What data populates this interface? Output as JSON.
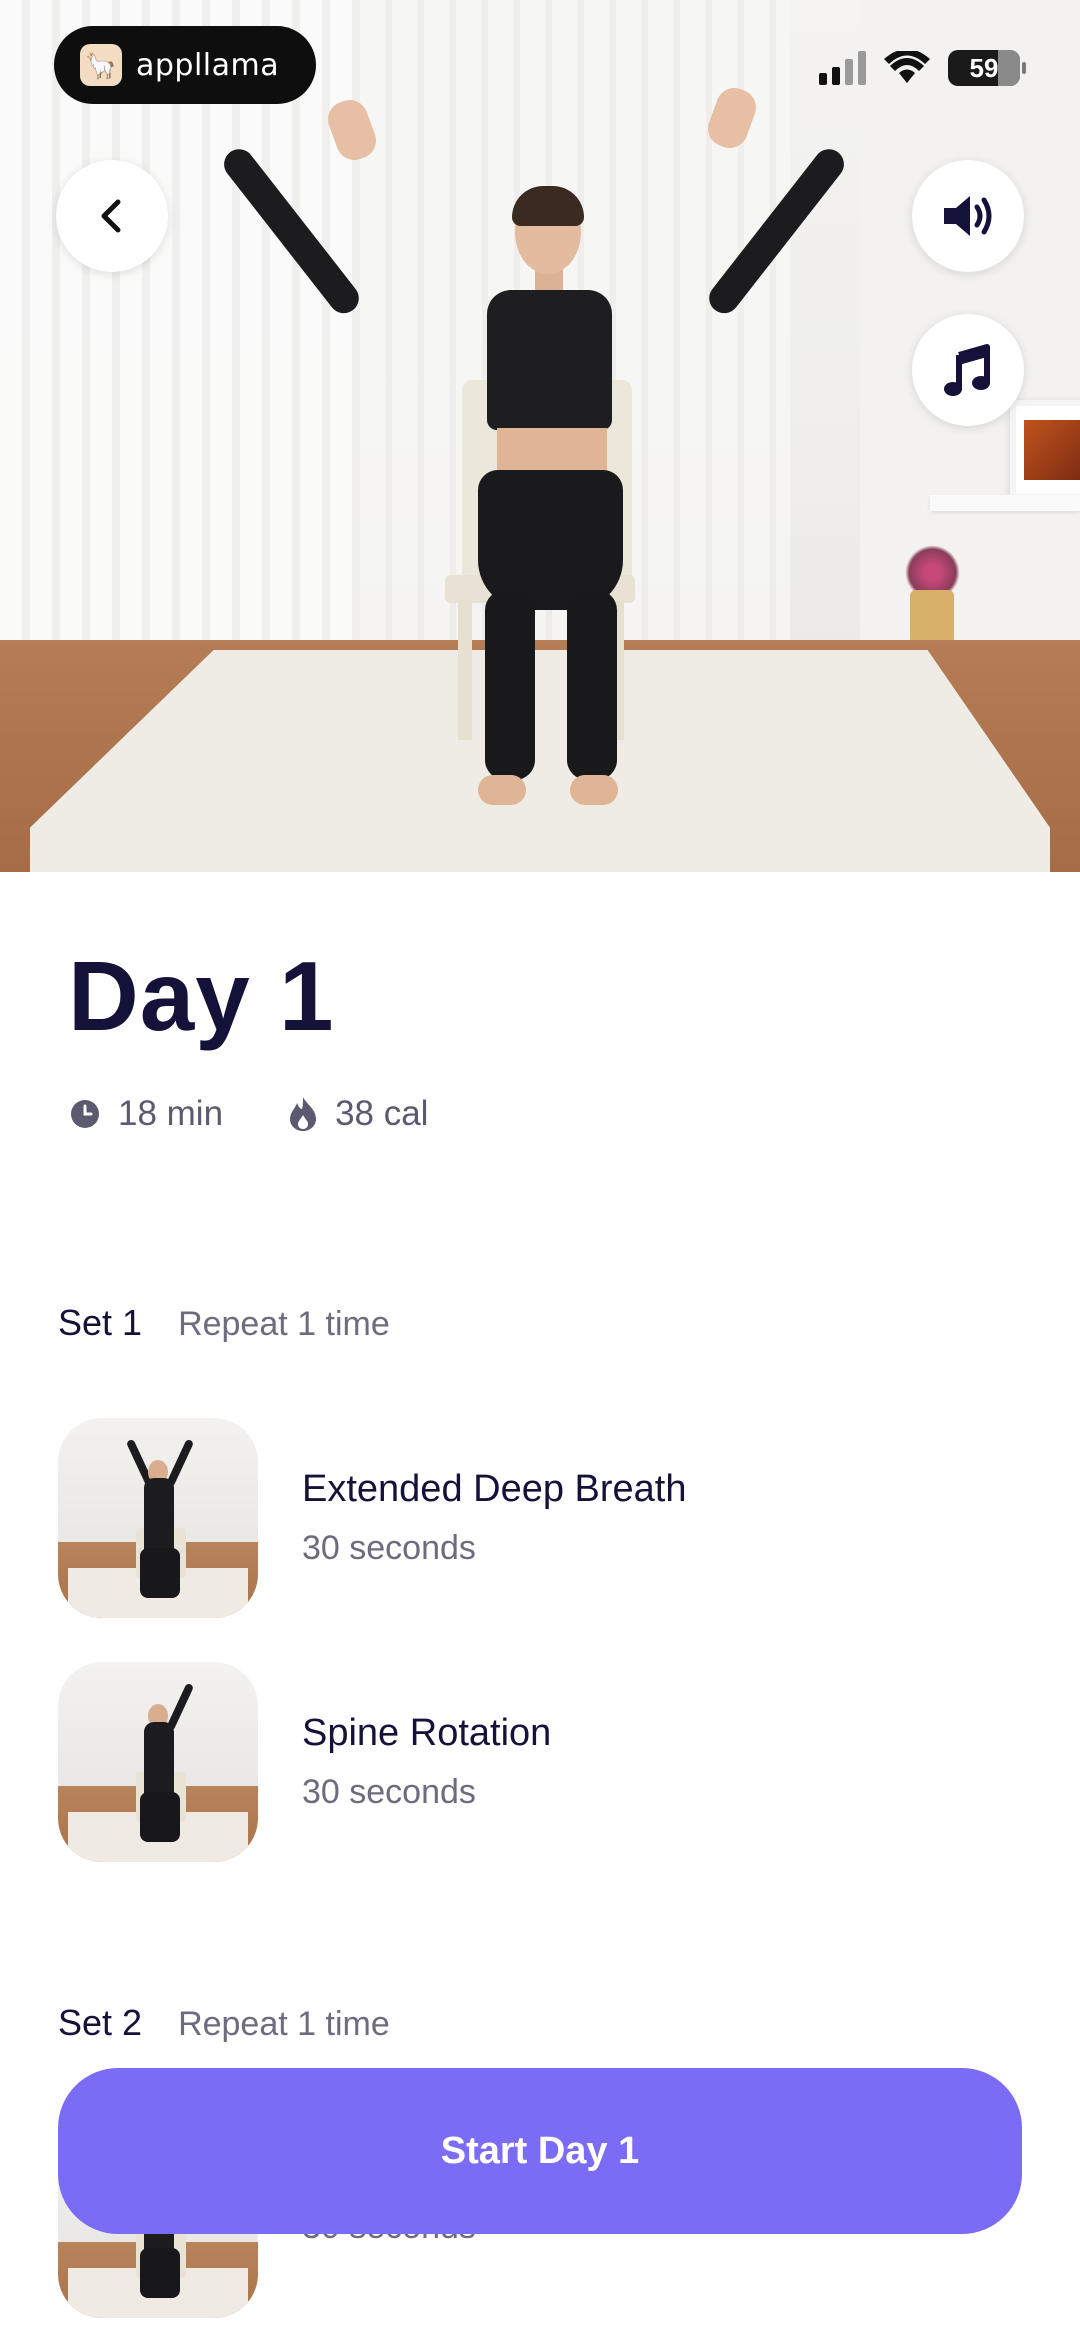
{
  "status_bar": {
    "brand_name": "appllama",
    "battery_level": "59"
  },
  "hero": {
    "image_description_icon": "workout-video-preview"
  },
  "workout": {
    "title": "Day 1",
    "duration": "18 min",
    "calories": "38 cal"
  },
  "sets": [
    {
      "label": "Set 1",
      "repeat": "Repeat 1 time",
      "exercises": [
        {
          "name": "Extended Deep Breath",
          "duration": "30 seconds"
        },
        {
          "name": "Spine Rotation",
          "duration": "30 seconds"
        }
      ]
    },
    {
      "label": "Set 2",
      "repeat": "Repeat 1 time",
      "exercises": [
        {
          "name": "",
          "duration": "30 seconds"
        }
      ]
    }
  ],
  "cta": {
    "label": "Start Day 1"
  },
  "colors": {
    "accent": "#7b6cf6",
    "title": "#15123a",
    "muted": "#6d6c7e"
  }
}
